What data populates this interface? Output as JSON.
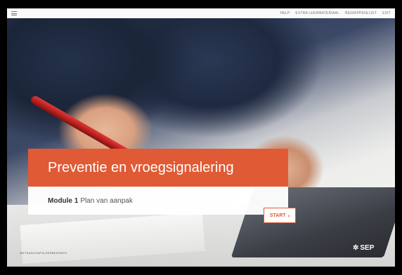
{
  "nav": {
    "links": [
      "HELP",
      "EXTRA LEERMATERIAAL",
      "BEGRIPPENLIJST",
      "EXIT"
    ]
  },
  "hero": {
    "title": "Preventie en vroegsignalering",
    "module_label": "Module 1",
    "module_title": "Plan van aanpak"
  },
  "start_button": {
    "label": "START",
    "chevron": "›"
  },
  "footer": {
    "left_text": "WETENSCHAPSLEERBEROEPS",
    "logo_text": "SEP"
  },
  "colors": {
    "accent": "#e05a35"
  },
  "icons": {
    "menu": "hamburger-menu-icon",
    "start": "chevron-right-icon",
    "logo": "sep-logo-icon"
  }
}
